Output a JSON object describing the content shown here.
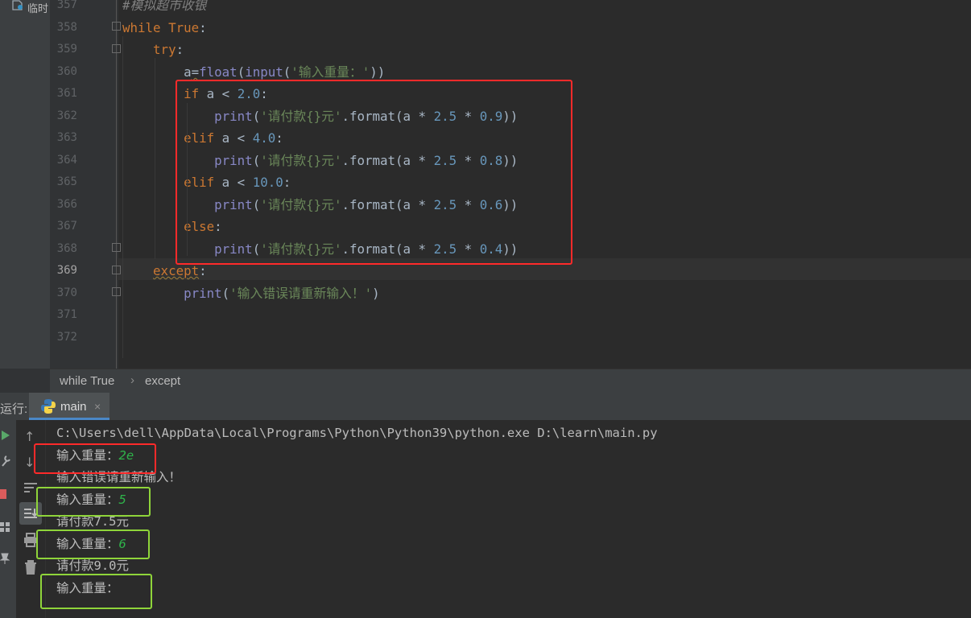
{
  "project": {
    "label": "临时"
  },
  "editor": {
    "lines": [
      {
        "num": "357",
        "html": "<span class=\"cm\">#模拟超市收银</span>"
      },
      {
        "num": "358",
        "html": "<span class=\"kw\">while True</span>:"
      },
      {
        "num": "359",
        "html": "    <span class=\"kw\">try</span>:"
      },
      {
        "num": "360",
        "html": "        a<span class=\"squig\">=</span><span class=\"bi\">float</span>(<span class=\"bi\">input</span>(<span class=\"str\">'输入重量：'</span>))"
      },
      {
        "num": "361",
        "html": "        <span class=\"kw\">if</span> a &lt; <span class=\"num\">2.0</span>:"
      },
      {
        "num": "362",
        "html": "            <span class=\"bi\">print</span>(<span class=\"str\">'请付款{}元'</span>.format(a * <span class=\"num\">2.5</span> * <span class=\"num\">0.9</span>))"
      },
      {
        "num": "363",
        "html": "        <span class=\"kw\">elif</span> a &lt; <span class=\"num\">4.0</span>:"
      },
      {
        "num": "364",
        "html": "            <span class=\"bi\">print</span>(<span class=\"str\">'请付款{}元'</span>.format(a * <span class=\"num\">2.5</span> * <span class=\"num\">0.8</span>))"
      },
      {
        "num": "365",
        "html": "        <span class=\"kw\">elif</span> a &lt; <span class=\"num\">10.0</span>:"
      },
      {
        "num": "366",
        "html": "            <span class=\"bi\">print</span>(<span class=\"str\">'请付款{}元'</span>.format(a * <span class=\"num\">2.5</span> * <span class=\"num\">0.6</span>))"
      },
      {
        "num": "367",
        "html": "        <span class=\"kw\">else</span>:"
      },
      {
        "num": "368",
        "html": "            <span class=\"bi\">print</span>(<span class=\"str\">'请付款{}元'</span>.format(a * <span class=\"num\">2.5</span> * <span class=\"num\">0.4</span>))"
      },
      {
        "num": "369",
        "html": "    <span class=\"kw squig\">except</span>:"
      },
      {
        "num": "370",
        "html": "        <span class=\"bi\">print</span>(<span class=\"str\">'输入错误请重新输入！'</span>)"
      },
      {
        "num": "371",
        "html": ""
      },
      {
        "num": "372",
        "html": ""
      }
    ]
  },
  "breadcrumb": {
    "item1": "while True",
    "separator": "›",
    "item2": "except"
  },
  "run": {
    "label": "运行:",
    "tab_title": "main",
    "tab_close": "×"
  },
  "console": {
    "command": "C:\\Users\\dell\\AppData\\Local\\Programs\\Python\\Python39\\python.exe D:\\learn\\main.py",
    "prompt1": "输入重量：",
    "input1": "2e",
    "error": "输入错误请重新输入！",
    "prompt2": "输入重量：",
    "input2": "5",
    "result2": "请付款7.5元",
    "prompt3": "输入重量：",
    "input3": "6",
    "result3": "请付款9.0元",
    "prompt4": "输入重量："
  },
  "colors": {
    "annotation_red": "#ff2a2a",
    "annotation_green": "#8fd53a",
    "keyword": "#cc7832",
    "string": "#6a8759",
    "number": "#6897bb"
  }
}
